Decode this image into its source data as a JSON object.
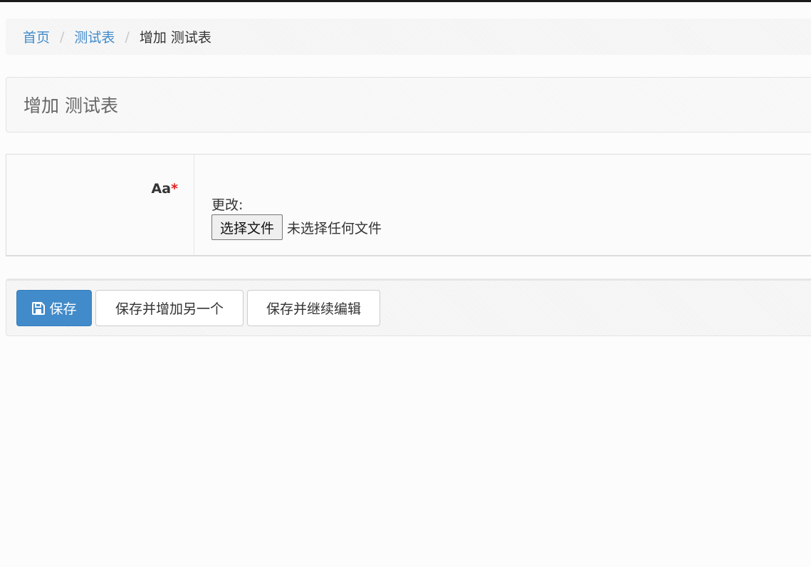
{
  "breadcrumb": {
    "home": "首页",
    "separator": "/",
    "section": "测试表",
    "current": "增加 测试表"
  },
  "page": {
    "title": "增加 测试表"
  },
  "form": {
    "field_label": "Aa",
    "required_mark": "*",
    "change_label": "更改:",
    "file_button": "选择文件",
    "file_status": "未选择任何文件"
  },
  "actions": {
    "save": "保存",
    "save_add_another": "保存并增加另一个",
    "save_continue": "保存并继续编辑"
  },
  "colors": {
    "link": "#428bca",
    "primary": "#428bca",
    "required": "#e02020"
  },
  "icons": {
    "save": "floppy-disk-icon"
  }
}
